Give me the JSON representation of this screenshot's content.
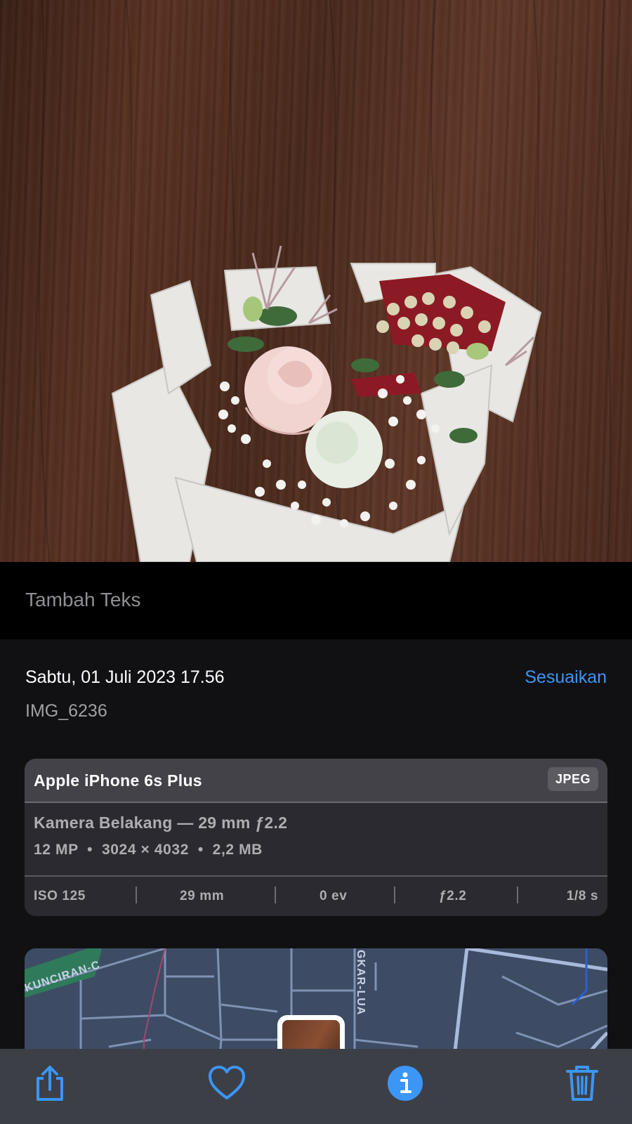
{
  "caption": {
    "placeholder": "Tambah Teks"
  },
  "info": {
    "date": "Sabtu, 01 Juli 2023 17.56",
    "adjust_label": "Sesuaikan",
    "filename": "IMG_6236"
  },
  "camera_card": {
    "device": "Apple iPhone 6s Plus",
    "format": "JPEG",
    "lens": "Kamera Belakang — 29 mm ƒ2.2",
    "specs": "12 MP  •  3024 × 4032  •  2,2 MB",
    "exif": {
      "iso": "ISO 125",
      "focal_length": "29 mm",
      "exposure": "0 ev",
      "aperture": "ƒ2.2",
      "shutter": "1/8 s"
    }
  },
  "map": {
    "road_label_1": "KUNCIRAN-C",
    "road_label_2": "GKAR-LUA"
  },
  "toolbar": {
    "share": "share-icon",
    "favorite": "heart-icon",
    "info": "info-icon",
    "delete": "trash-icon",
    "accent_color": "#3b96f5"
  }
}
